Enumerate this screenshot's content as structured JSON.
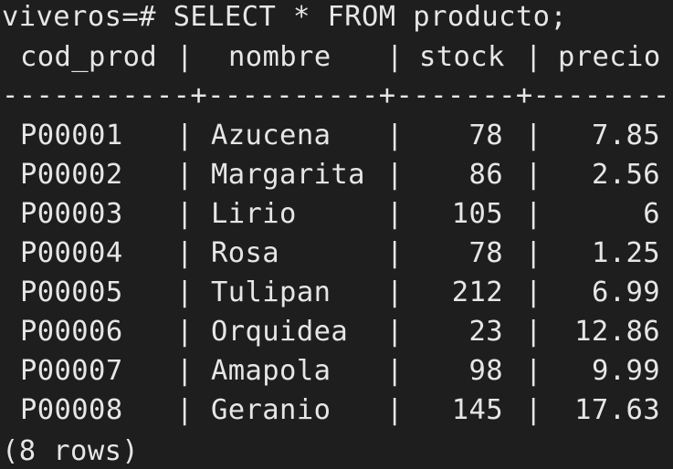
{
  "terminal": {
    "prompt": "viveros=# SELECT * FROM producto;",
    "separator": "-----------+----------+-------+--------",
    "footer": "(8 rows)"
  },
  "table": {
    "columns": [
      "cod_prod",
      "nombre",
      "stock",
      "precio"
    ],
    "pipe": "|",
    "rows": [
      {
        "cod_prod": "P00001",
        "nombre": "Azucena",
        "stock": "78",
        "precio": "7.85"
      },
      {
        "cod_prod": "P00002",
        "nombre": "Margarita",
        "stock": "86",
        "precio": "2.56"
      },
      {
        "cod_prod": "P00003",
        "nombre": "Lirio",
        "stock": "105",
        "precio": "6"
      },
      {
        "cod_prod": "P00004",
        "nombre": "Rosa",
        "stock": "78",
        "precio": "1.25"
      },
      {
        "cod_prod": "P00005",
        "nombre": "Tulipan",
        "stock": "212",
        "precio": "6.99"
      },
      {
        "cod_prod": "P00006",
        "nombre": "Orquidea",
        "stock": "23",
        "precio": "12.86"
      },
      {
        "cod_prod": "P00007",
        "nombre": "Amapola",
        "stock": "98",
        "precio": "9.99"
      },
      {
        "cod_prod": "P00008",
        "nombre": "Geranio",
        "stock": "145",
        "precio": "17.63"
      }
    ]
  },
  "colors": {
    "background": "#1e1e1e",
    "text": "#e6e6e6"
  }
}
